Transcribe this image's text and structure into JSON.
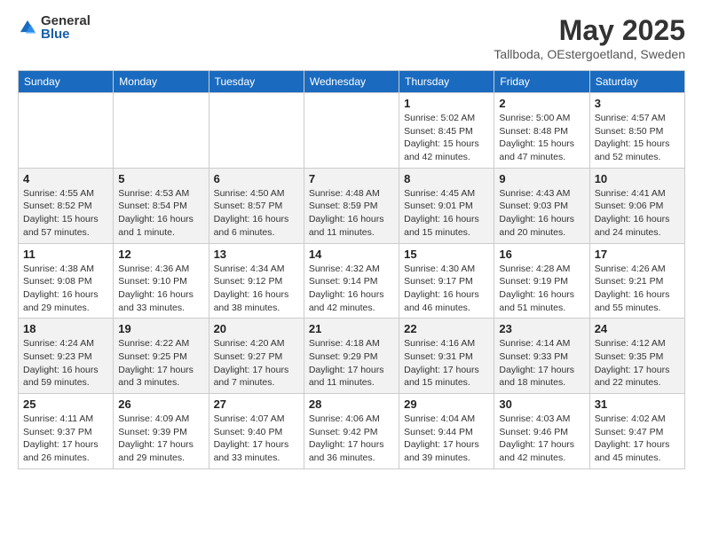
{
  "logo": {
    "general": "General",
    "blue": "Blue"
  },
  "header": {
    "month": "May 2025",
    "location": "Tallboda, OEstergoetland, Sweden"
  },
  "days_of_week": [
    "Sunday",
    "Monday",
    "Tuesday",
    "Wednesday",
    "Thursday",
    "Friday",
    "Saturday"
  ],
  "weeks": [
    [
      {
        "day": "",
        "info": ""
      },
      {
        "day": "",
        "info": ""
      },
      {
        "day": "",
        "info": ""
      },
      {
        "day": "",
        "info": ""
      },
      {
        "day": "1",
        "info": "Sunrise: 5:02 AM\nSunset: 8:45 PM\nDaylight: 15 hours\nand 42 minutes."
      },
      {
        "day": "2",
        "info": "Sunrise: 5:00 AM\nSunset: 8:48 PM\nDaylight: 15 hours\nand 47 minutes."
      },
      {
        "day": "3",
        "info": "Sunrise: 4:57 AM\nSunset: 8:50 PM\nDaylight: 15 hours\nand 52 minutes."
      }
    ],
    [
      {
        "day": "4",
        "info": "Sunrise: 4:55 AM\nSunset: 8:52 PM\nDaylight: 15 hours\nand 57 minutes."
      },
      {
        "day": "5",
        "info": "Sunrise: 4:53 AM\nSunset: 8:54 PM\nDaylight: 16 hours\nand 1 minute."
      },
      {
        "day": "6",
        "info": "Sunrise: 4:50 AM\nSunset: 8:57 PM\nDaylight: 16 hours\nand 6 minutes."
      },
      {
        "day": "7",
        "info": "Sunrise: 4:48 AM\nSunset: 8:59 PM\nDaylight: 16 hours\nand 11 minutes."
      },
      {
        "day": "8",
        "info": "Sunrise: 4:45 AM\nSunset: 9:01 PM\nDaylight: 16 hours\nand 15 minutes."
      },
      {
        "day": "9",
        "info": "Sunrise: 4:43 AM\nSunset: 9:03 PM\nDaylight: 16 hours\nand 20 minutes."
      },
      {
        "day": "10",
        "info": "Sunrise: 4:41 AM\nSunset: 9:06 PM\nDaylight: 16 hours\nand 24 minutes."
      }
    ],
    [
      {
        "day": "11",
        "info": "Sunrise: 4:38 AM\nSunset: 9:08 PM\nDaylight: 16 hours\nand 29 minutes."
      },
      {
        "day": "12",
        "info": "Sunrise: 4:36 AM\nSunset: 9:10 PM\nDaylight: 16 hours\nand 33 minutes."
      },
      {
        "day": "13",
        "info": "Sunrise: 4:34 AM\nSunset: 9:12 PM\nDaylight: 16 hours\nand 38 minutes."
      },
      {
        "day": "14",
        "info": "Sunrise: 4:32 AM\nSunset: 9:14 PM\nDaylight: 16 hours\nand 42 minutes."
      },
      {
        "day": "15",
        "info": "Sunrise: 4:30 AM\nSunset: 9:17 PM\nDaylight: 16 hours\nand 46 minutes."
      },
      {
        "day": "16",
        "info": "Sunrise: 4:28 AM\nSunset: 9:19 PM\nDaylight: 16 hours\nand 51 minutes."
      },
      {
        "day": "17",
        "info": "Sunrise: 4:26 AM\nSunset: 9:21 PM\nDaylight: 16 hours\nand 55 minutes."
      }
    ],
    [
      {
        "day": "18",
        "info": "Sunrise: 4:24 AM\nSunset: 9:23 PM\nDaylight: 16 hours\nand 59 minutes."
      },
      {
        "day": "19",
        "info": "Sunrise: 4:22 AM\nSunset: 9:25 PM\nDaylight: 17 hours\nand 3 minutes."
      },
      {
        "day": "20",
        "info": "Sunrise: 4:20 AM\nSunset: 9:27 PM\nDaylight: 17 hours\nand 7 minutes."
      },
      {
        "day": "21",
        "info": "Sunrise: 4:18 AM\nSunset: 9:29 PM\nDaylight: 17 hours\nand 11 minutes."
      },
      {
        "day": "22",
        "info": "Sunrise: 4:16 AM\nSunset: 9:31 PM\nDaylight: 17 hours\nand 15 minutes."
      },
      {
        "day": "23",
        "info": "Sunrise: 4:14 AM\nSunset: 9:33 PM\nDaylight: 17 hours\nand 18 minutes."
      },
      {
        "day": "24",
        "info": "Sunrise: 4:12 AM\nSunset: 9:35 PM\nDaylight: 17 hours\nand 22 minutes."
      }
    ],
    [
      {
        "day": "25",
        "info": "Sunrise: 4:11 AM\nSunset: 9:37 PM\nDaylight: 17 hours\nand 26 minutes."
      },
      {
        "day": "26",
        "info": "Sunrise: 4:09 AM\nSunset: 9:39 PM\nDaylight: 17 hours\nand 29 minutes."
      },
      {
        "day": "27",
        "info": "Sunrise: 4:07 AM\nSunset: 9:40 PM\nDaylight: 17 hours\nand 33 minutes."
      },
      {
        "day": "28",
        "info": "Sunrise: 4:06 AM\nSunset: 9:42 PM\nDaylight: 17 hours\nand 36 minutes."
      },
      {
        "day": "29",
        "info": "Sunrise: 4:04 AM\nSunset: 9:44 PM\nDaylight: 17 hours\nand 39 minutes."
      },
      {
        "day": "30",
        "info": "Sunrise: 4:03 AM\nSunset: 9:46 PM\nDaylight: 17 hours\nand 42 minutes."
      },
      {
        "day": "31",
        "info": "Sunrise: 4:02 AM\nSunset: 9:47 PM\nDaylight: 17 hours\nand 45 minutes."
      }
    ]
  ]
}
